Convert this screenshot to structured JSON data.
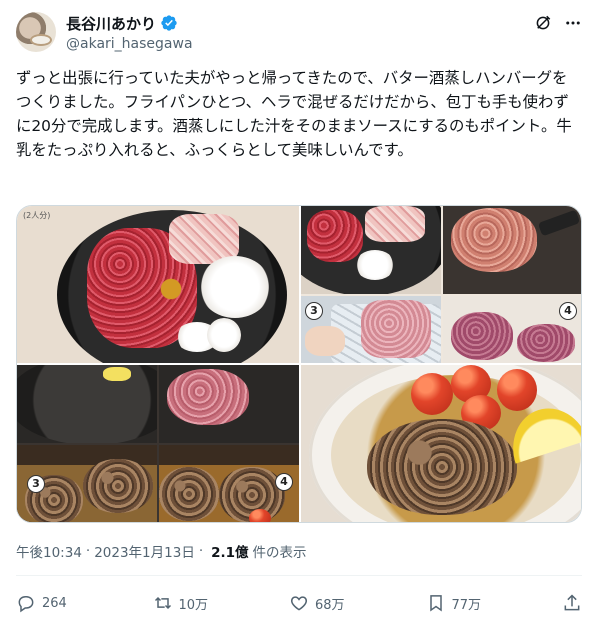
{
  "user": {
    "name": "長谷川あかり",
    "handle": "@akari_hasegawa",
    "verified": true
  },
  "tweet": {
    "text": "ずっと出張に行っていた夫がやっと帰ってきたので、バター酒蒸しハンバーグをつくりました。フライパンひとつ、ヘラで混ぜるだけだから、包丁も手も使わずに20分で完成します。酒蒸しにした汁をそのままソースにするのもポイント。牛乳をたっぷり入れると、ふっくらとして美味しいんです。"
  },
  "media": {
    "note": "(2人分)",
    "steps": {
      "s3a": "3",
      "s4a": "4",
      "s3b": "3",
      "s4b": "4"
    }
  },
  "meta": {
    "time": "午後10:34",
    "sep": "·",
    "date": "2023年1月13日",
    "sep2": "·",
    "views": "2.1億",
    "views_label": "件の表示"
  },
  "actions": {
    "replies": "264",
    "retweets": "10万",
    "likes": "68万",
    "bookmarks": "77万"
  },
  "icons": [
    "verified-badge-icon",
    "grok-icon",
    "more-icon",
    "reply-icon",
    "retweet-icon",
    "like-icon",
    "bookmark-icon",
    "share-icon"
  ],
  "colors": {
    "accent": "#1d9bf0",
    "secondary_text": "#536471"
  }
}
